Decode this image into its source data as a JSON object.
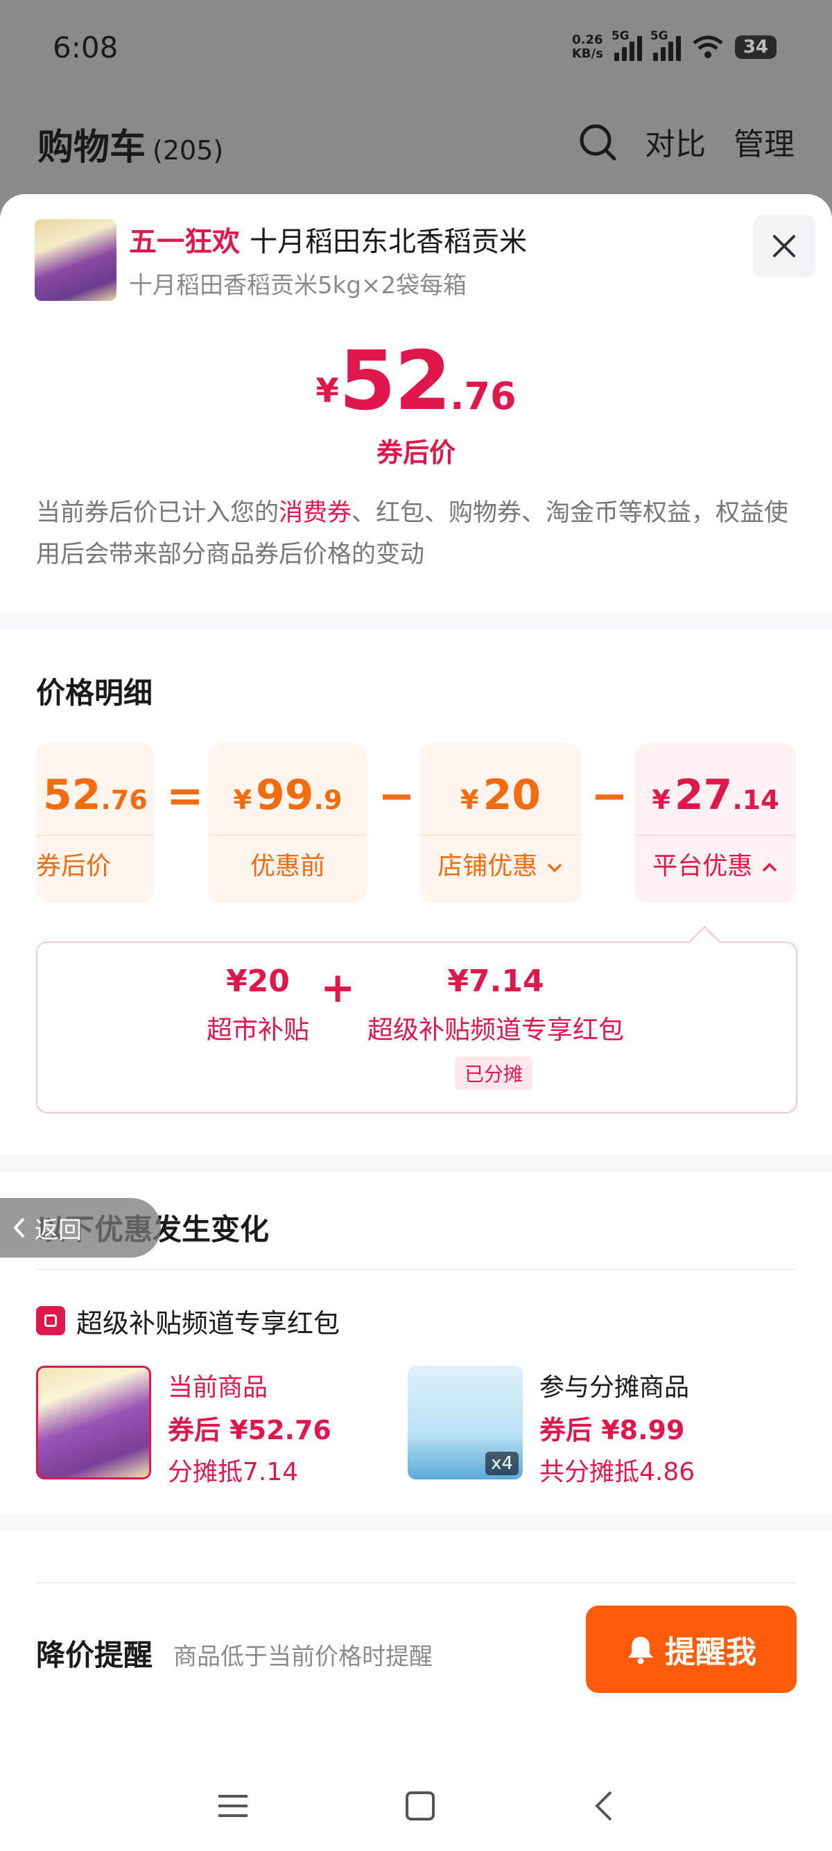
{
  "status_bar": {
    "time": "6:08",
    "net_speed_top": "0.26",
    "net_speed_unit": "KB/s",
    "sig1_tag": "5G",
    "sig2_tag": "5G",
    "battery": "34"
  },
  "header": {
    "title": "购物车",
    "count": "(205)",
    "compare": "对比",
    "manage": "管理"
  },
  "product": {
    "promo_tag": "五一狂欢",
    "name": "十月稻田东北香稻贡米",
    "spec": "十月稻田香稻贡米5kg×2袋每箱"
  },
  "price": {
    "currency": "¥",
    "integer": "52",
    "decimal": ".76",
    "label": "券后价"
  },
  "notice": {
    "part1": "当前券后价已计入您的",
    "highlight": "消费券",
    "part2": "、红包、购物券、淘金币等权益，权益使用后会带来部分商品券后价格的变动"
  },
  "breakdown": {
    "title": "价格明细",
    "result": {
      "integer": "52",
      "decimal": ".76",
      "label": "券后价"
    },
    "equals": "=",
    "minus": "−",
    "items": [
      {
        "currency": "¥",
        "integer": "99",
        "decimal": ".9",
        "label": "优惠前"
      },
      {
        "currency": "¥",
        "integer": "20",
        "decimal": "",
        "label": "店铺优惠"
      },
      {
        "currency": "¥",
        "integer": "27",
        "decimal": ".14",
        "label": "平台优惠"
      }
    ]
  },
  "subsidy": {
    "plus": "+",
    "items": [
      {
        "amount": "¥20",
        "name": "超市补贴"
      },
      {
        "amount": "¥7.14",
        "name": "超级补贴频道专享红包"
      }
    ],
    "badge": "已分摊"
  },
  "changes": {
    "back": "返回",
    "title": "以下优惠发生变化",
    "redpack_title": "超级补贴频道专享红包",
    "current": {
      "label": "当前商品",
      "price": "券后 ¥52.76",
      "share": "分摊抵7.14"
    },
    "other": {
      "label": "参与分摊商品",
      "price": "券后 ¥8.99",
      "share": "共分摊抵4.86",
      "qty": "x4"
    }
  },
  "reminder": {
    "label": "降价提醒",
    "desc": "商品低于当前价格时提醒",
    "button": "提醒我"
  },
  "colors": {
    "accent_red": "#e0174d",
    "accent_orange": "#f26b0f",
    "button_orange": "#ff5c0a"
  }
}
